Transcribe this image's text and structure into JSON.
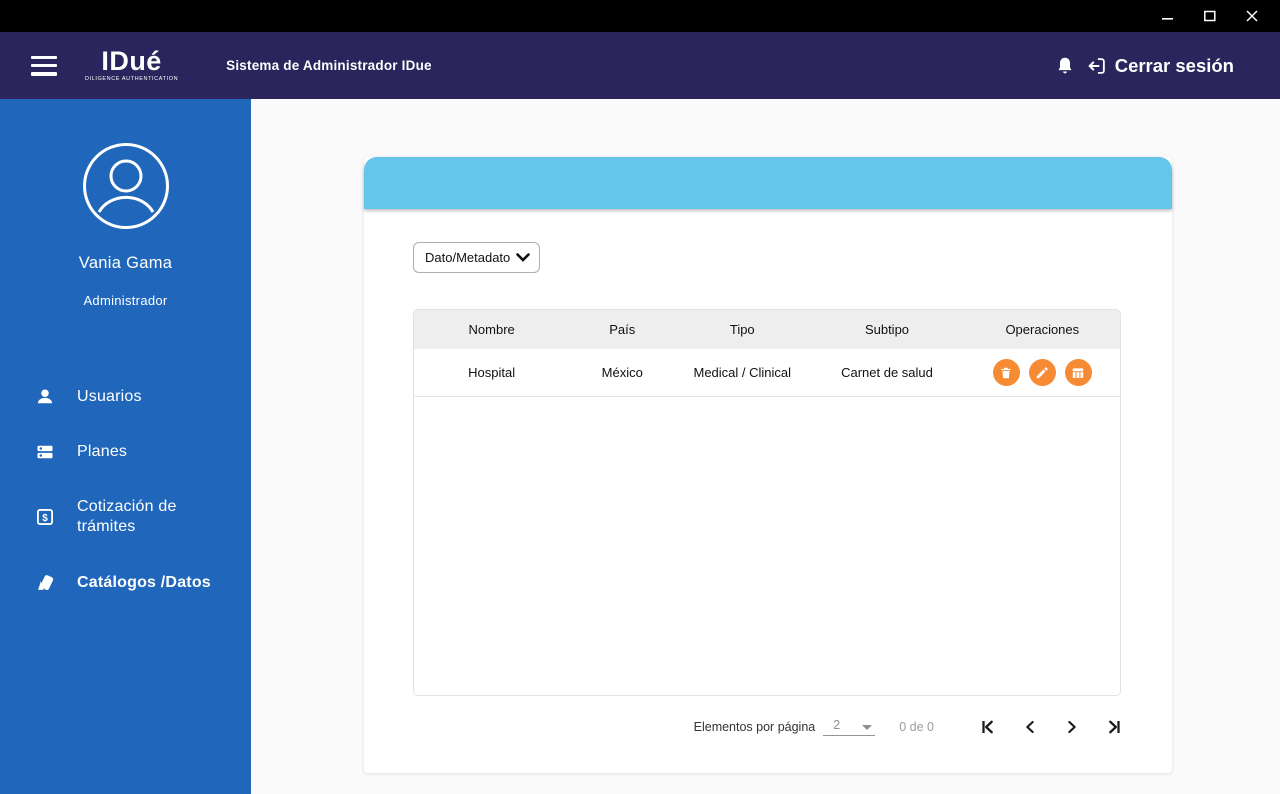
{
  "window": {
    "controls": [
      "minimize",
      "maximize",
      "close"
    ]
  },
  "appbar": {
    "logo": {
      "text": "IDué",
      "subtext": "DILIGENCE AUTHENTICATION"
    },
    "title": "Sistema de Administrador IDue",
    "logout_label": "Cerrar sesión"
  },
  "sidebar": {
    "user": {
      "name": "Vania Gama",
      "role": "Administrador"
    },
    "items": [
      {
        "label": "Usuarios",
        "icon": "user-icon",
        "active": false
      },
      {
        "label": "Planes",
        "icon": "plans-icon",
        "active": false
      },
      {
        "label": "Cotización de trámites",
        "icon": "quote-dollar-icon",
        "active": false
      },
      {
        "label": "Catálogos /Datos",
        "icon": "catalogs-icon",
        "active": true
      }
    ]
  },
  "card": {
    "dropdown": {
      "value": "Dato/Metadato"
    }
  },
  "table": {
    "columns": [
      "Nombre",
      "País",
      "Tipo",
      "Subtipo",
      "Operaciones"
    ],
    "rows": [
      {
        "nombre": "Hospital",
        "pais": "México",
        "tipo": "Medical / Clinical",
        "subtipo": "Carnet de salud",
        "operations": [
          "delete-icon",
          "edit-icon",
          "table-icon"
        ]
      }
    ]
  },
  "pagination": {
    "items_per_page_label": "Elementos por página",
    "page_size": "2",
    "range": "0 de 0",
    "controls": [
      "first-page",
      "previous-page",
      "next-page",
      "last-page"
    ]
  },
  "fab": {
    "icon": "plus-icon"
  },
  "colors": {
    "titlebar_black": "#000000",
    "header_navy": "#2a255c",
    "sidebar_blue": "#2067bb",
    "topbar_sky": "#65c6ec",
    "accent_orange": "#f6872a",
    "table_header_gray": "#eeeeee",
    "muted_text": "#9d9d9d"
  }
}
